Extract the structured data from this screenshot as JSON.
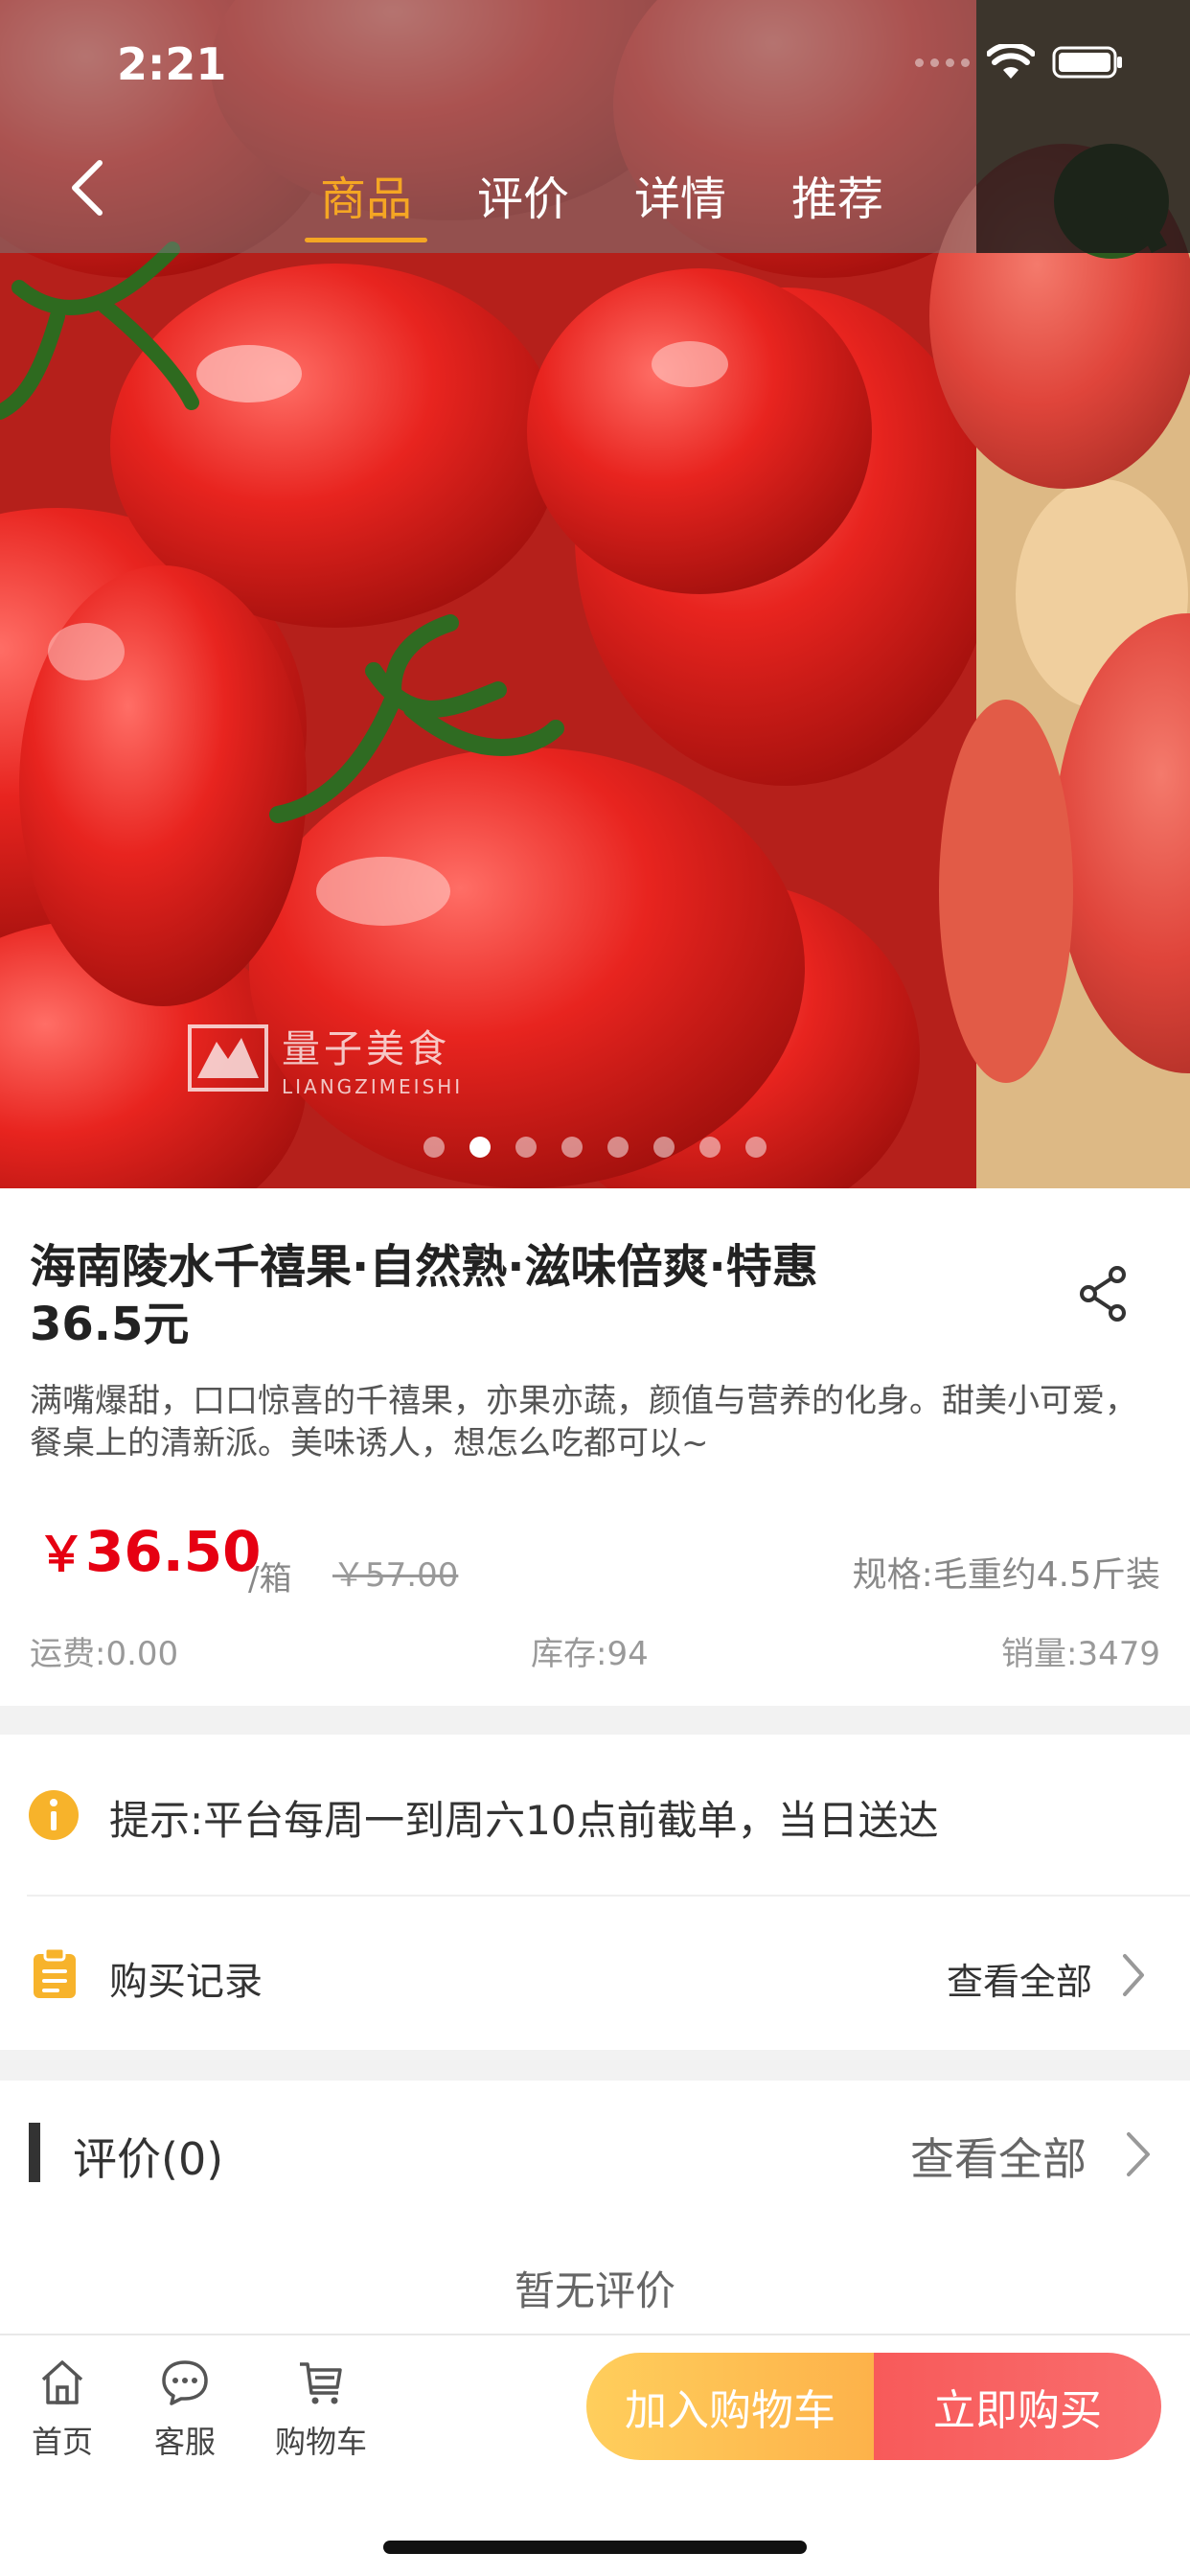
{
  "status_bar": {
    "time": "2:21"
  },
  "nav": {
    "tabs": [
      {
        "label": "商品"
      },
      {
        "label": "评价"
      },
      {
        "label": "详情"
      },
      {
        "label": "推荐"
      }
    ],
    "active_tab": "商品"
  },
  "gallery": {
    "watermark_cn": "量子美食",
    "watermark_en": "LIANGZIMEISHI",
    "slide_count": 8,
    "current_slide": 2
  },
  "product": {
    "title": "海南陵水千禧果·自然熟·滋味倍爽·特惠36.5元",
    "description": "满嘴爆甜，口口惊喜的千禧果，亦果亦蔬，颜值与营养的化身。甜美小可爱，餐桌上的清新派。美味诱人，想怎么吃都可以~",
    "price_symbol": "￥",
    "price": "36.50",
    "unit": "/箱",
    "original_price": "￥57.00",
    "spec": "规格:毛重约4.5斤装",
    "shipping": "运费:0.00",
    "stock": "库存:94",
    "sales": "销量:3479"
  },
  "notice": {
    "text": "提示:平台每周一到周六10点前截单，当日送达"
  },
  "purchase_record": {
    "label": "购买记录",
    "more": "查看全部"
  },
  "reviews": {
    "title": "评价(0)",
    "more": "查看全部",
    "empty": "暂无评价"
  },
  "bottom_bar": {
    "home": "首页",
    "service": "客服",
    "cart": "购物车",
    "add_to_cart": "加入购物车",
    "buy_now": "立即购买"
  },
  "colors": {
    "accent": "#f5a623",
    "price": "#e60012",
    "cart_button": "#fdb24a",
    "buy_button": "#f85a5a"
  }
}
